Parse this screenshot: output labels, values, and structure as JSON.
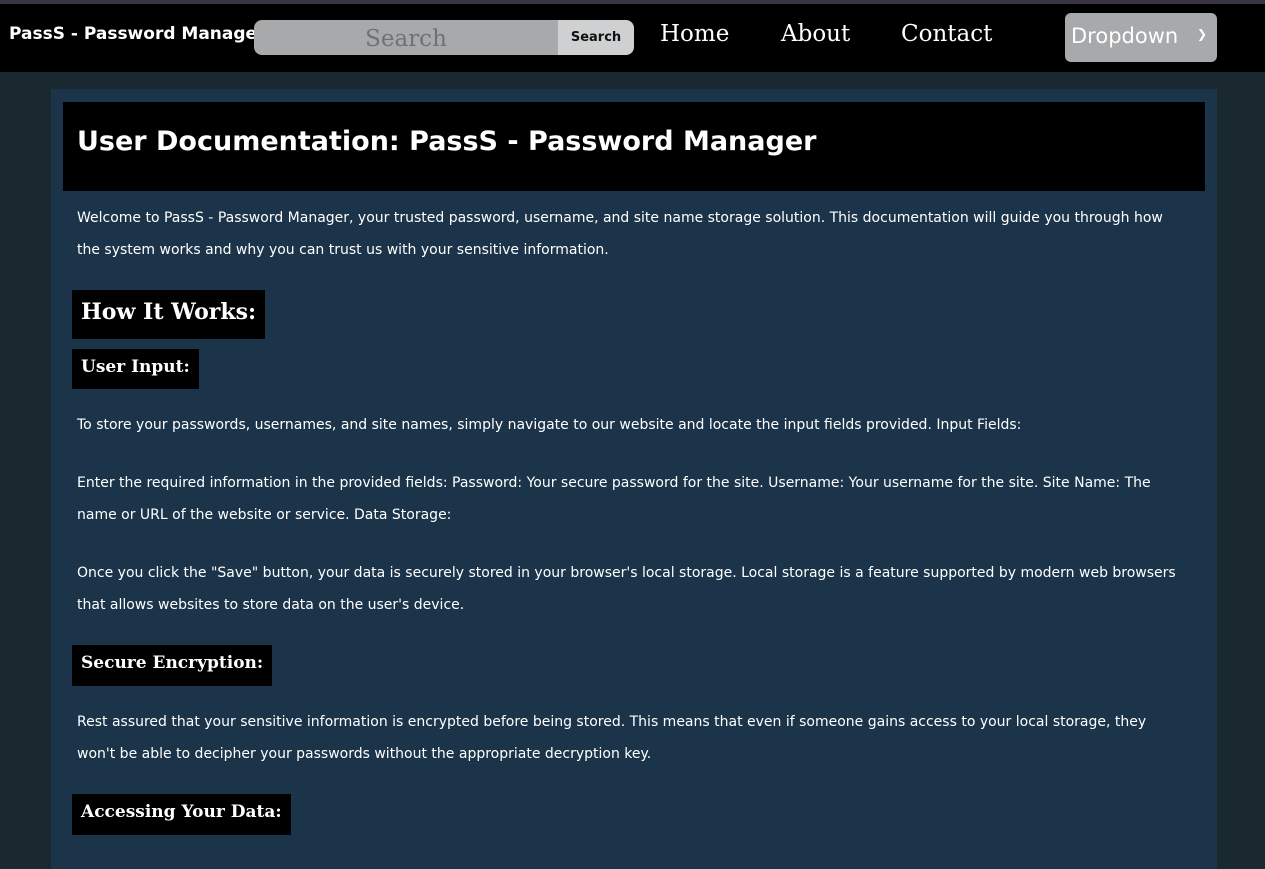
{
  "navbar": {
    "brand": "PassS - Password Manager",
    "search_placeholder": "Search",
    "search_button": "Search",
    "links": [
      "Home",
      "About",
      "Contact"
    ],
    "dropdown_label": "Dropdown"
  },
  "doc": {
    "title": "User Documentation: PassS - Password Manager",
    "intro": "Welcome to PassS - Password Manager, your trusted password, username, and site name storage solution. This documentation will guide you through how the system works and why you can trust us with your sensitive information.",
    "how_it_works": "How It Works:",
    "user_input_heading": "User Input:",
    "user_input_p1": "To store your passwords, usernames, and site names, simply navigate to our website and locate the input fields provided. Input Fields:",
    "user_input_p2": "Enter the required information in the provided fields: Password: Your secure password for the site. Username: Your username for the site. Site Name: The name or URL of the website or service. Data Storage:",
    "user_input_p3": "Once you click the \"Save\" button, your data is securely stored in your browser's local storage. Local storage is a feature supported by modern web browsers that allows websites to store data on the user's device.",
    "secure_heading": "Secure Encryption:",
    "secure_p": "Rest assured that your sensitive information is encrypted before being stored. This means that even if someone gains access to your local storage, they won't be able to decipher your passwords without the appropriate decryption key.",
    "accessing_heading": "Accessing Your Data:"
  },
  "colors": {
    "navbar": "#000000",
    "page_bg": "#1a2830",
    "content_bg": "#1b3449",
    "heading_bg": "#000000"
  }
}
